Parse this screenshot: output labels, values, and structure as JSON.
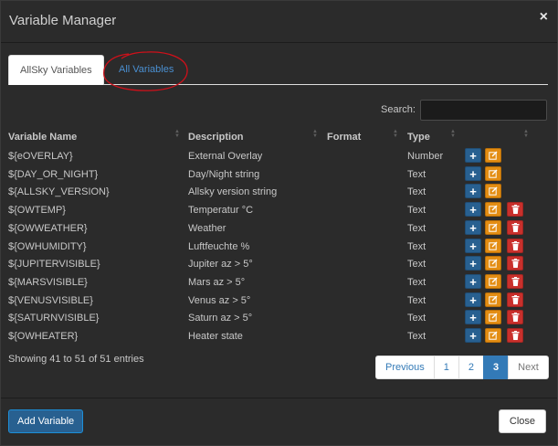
{
  "modal": {
    "title": "Variable Manager",
    "close_icon": "close-icon"
  },
  "tabs": [
    {
      "label": "AllSky Variables",
      "active": true
    },
    {
      "label": "All Variables",
      "active": false
    }
  ],
  "search": {
    "label": "Search:",
    "value": ""
  },
  "table": {
    "columns": [
      "Variable Name",
      "Description",
      "Format",
      "Type"
    ],
    "rows": [
      {
        "name": "${eOVERLAY}",
        "description": "External Overlay",
        "format": "",
        "type": "Number",
        "deletable": false
      },
      {
        "name": "${DAY_OR_NIGHT}",
        "description": "Day/Night string",
        "format": "",
        "type": "Text",
        "deletable": false
      },
      {
        "name": "${ALLSKY_VERSION}",
        "description": "Allsky version string",
        "format": "",
        "type": "Text",
        "deletable": false
      },
      {
        "name": "${OWTEMP}",
        "description": "Temperatur °C",
        "format": "",
        "type": "Text",
        "deletable": true
      },
      {
        "name": "${OWWEATHER}",
        "description": "Weather",
        "format": "",
        "type": "Text",
        "deletable": true
      },
      {
        "name": "${OWHUMIDITY}",
        "description": "Luftfeuchte %",
        "format": "",
        "type": "Text",
        "deletable": true
      },
      {
        "name": "${JUPITERVISIBLE}",
        "description": "Jupiter az > 5°",
        "format": "",
        "type": "Text",
        "deletable": true
      },
      {
        "name": "${MARSVISIBLE}",
        "description": "Mars az > 5°",
        "format": "",
        "type": "Text",
        "deletable": true
      },
      {
        "name": "${VENUSVISIBLE}",
        "description": "Venus az > 5°",
        "format": "",
        "type": "Text",
        "deletable": true
      },
      {
        "name": "${SATURNVISIBLE}",
        "description": "Saturn az > 5°",
        "format": "",
        "type": "Text",
        "deletable": true
      },
      {
        "name": "${OWHEATER}",
        "description": "Heater state",
        "format": "",
        "type": "Text",
        "deletable": true
      }
    ]
  },
  "row_actions": {
    "add_label": "+",
    "edit_icon": "edit-icon",
    "delete_icon": "trash-icon"
  },
  "info": "Showing 41 to 51 of 51 entries",
  "pagination": {
    "previous": "Previous",
    "pages": [
      "1",
      "2",
      "3"
    ],
    "active_page": "3",
    "next": "Next"
  },
  "footer": {
    "add_button": "Add Variable",
    "close_button": "Close"
  },
  "colors": {
    "primary": "#286090",
    "edit": "#e38d13",
    "delete": "#c9302c",
    "annotation": "#d0101a",
    "link": "#4a8fd1"
  }
}
